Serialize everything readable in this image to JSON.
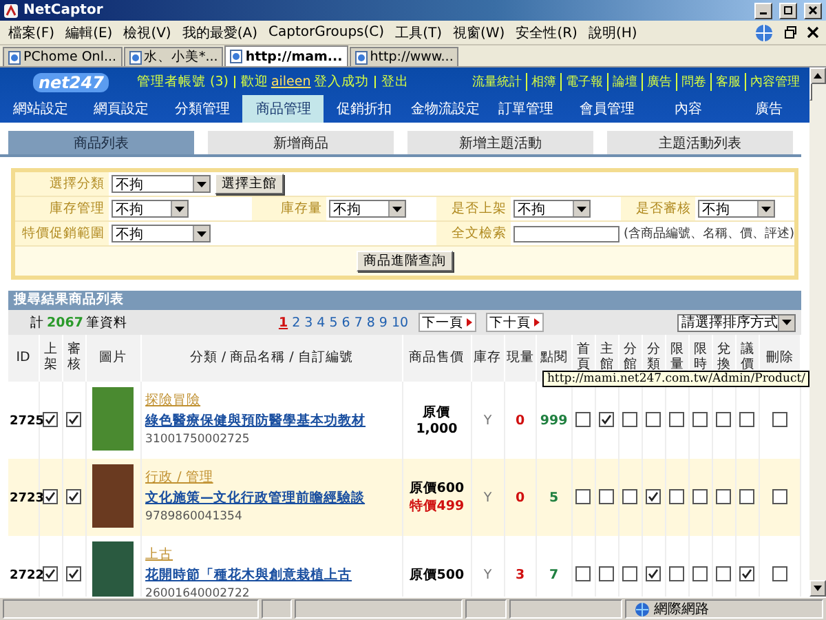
{
  "window": {
    "title": "NetCaptor"
  },
  "menu": [
    "檔案(F)",
    "編輯(E)",
    "檢視(V)",
    "我的最愛(A)",
    "CaptorGroups(C)",
    "工具(T)",
    "視窗(W)",
    "安全性(R)",
    "說明(H)"
  ],
  "browser_tabs": [
    {
      "label": "PChome Onl...",
      "selected": false
    },
    {
      "label": "水、小美*...",
      "selected": false
    },
    {
      "label": "http://mam...",
      "selected": true
    },
    {
      "label": "http://www...",
      "selected": false
    }
  ],
  "header": {
    "logo": "net247",
    "account": "管理者帳號 (3)",
    "greeting": "歡迎",
    "user": "aileen",
    "message": "登入成功",
    "logout": "登出",
    "links": [
      "流量統計",
      "相簿",
      "電子報",
      "論壇",
      "廣告",
      "問卷",
      "客服",
      "內容管理"
    ]
  },
  "nav": [
    {
      "label": "網站設定",
      "selected": false
    },
    {
      "label": "網頁設定",
      "selected": false
    },
    {
      "label": "分類管理",
      "selected": false
    },
    {
      "label": "商品管理",
      "selected": true
    },
    {
      "label": "促銷折扣",
      "selected": false
    },
    {
      "label": "金物流設定",
      "selected": false
    },
    {
      "label": "訂單管理",
      "selected": false
    },
    {
      "label": "會員管理",
      "selected": false
    },
    {
      "label": "內容",
      "selected": false
    },
    {
      "label": "廣告",
      "selected": false
    }
  ],
  "subtabs": [
    {
      "label": "商品列表",
      "selected": true
    },
    {
      "label": "新增商品",
      "selected": false
    },
    {
      "label": "新增主題活動",
      "selected": false
    },
    {
      "label": "主題活動列表",
      "selected": false
    }
  ],
  "search_form": {
    "rows": [
      [
        {
          "label": "選擇分類",
          "kind": "select",
          "value": "不拘",
          "button": "選擇主館"
        },
        "",
        "",
        ""
      ],
      [
        {
          "label": "庫存管理",
          "kind": "select",
          "value": "不拘"
        },
        {
          "label": "庫存量",
          "kind": "select",
          "value": "不拘"
        },
        {
          "label": "是否上架",
          "kind": "select",
          "value": "不拘"
        },
        {
          "label": "是否審核",
          "kind": "select",
          "value": "不拘"
        }
      ],
      [
        {
          "label": "特價促銷範圍",
          "kind": "select",
          "value": "不拘"
        },
        "",
        {
          "label": "全文檢索",
          "kind": "text",
          "note": "(含商品編號、名稱、價、評述)"
        },
        ""
      ]
    ],
    "submit": "商品進階查詢"
  },
  "results": {
    "title": "搜尋結果商品列表",
    "count_prefix": "計",
    "count": "2067",
    "count_suffix": "筆資料",
    "pages": [
      {
        "label": "1",
        "selected": true
      },
      {
        "label": "2",
        "selected": false
      },
      {
        "label": "3",
        "selected": false
      },
      {
        "label": "4",
        "selected": false
      },
      {
        "label": "5",
        "selected": false
      },
      {
        "label": "6",
        "selected": false
      },
      {
        "label": "7",
        "selected": false
      },
      {
        "label": "8",
        "selected": false
      },
      {
        "label": "9",
        "selected": false
      },
      {
        "label": "10",
        "selected": false
      }
    ],
    "next": "下一頁",
    "next_ten": "下十頁",
    "sort": "請選擇排序方式",
    "columns": [
      "ID",
      "上架",
      "審核",
      "圖片",
      "分類 / 商品名稱 / 自訂編號",
      "商品售價",
      "庫存",
      "現量",
      "點閱",
      "首頁",
      "主館",
      "分館",
      "分類",
      "限量",
      "限時",
      "兌換",
      "議價",
      "刪除"
    ],
    "rows": [
      {
        "id": "2725",
        "listed": true,
        "approved": true,
        "category": "探險冒險",
        "name": "綠色醫療保健與預防醫學基本功教材",
        "code": "31001750002725",
        "prices": [
          {
            "kind": "original",
            "text": "原價1,000"
          }
        ],
        "stock": "Y",
        "quantity": "0",
        "views": "999",
        "flags": [
          false,
          true,
          false,
          false,
          false,
          false,
          false,
          false
        ],
        "delete": false
      },
      {
        "id": "2723",
        "listed": true,
        "approved": true,
        "category": "行政 / 管理",
        "name": "文化施策—文化行政管理前瞻經驗談",
        "code": "9789860041354",
        "prices": [
          {
            "kind": "original",
            "text": "原價600"
          },
          {
            "kind": "special",
            "text": "特價499"
          }
        ],
        "stock": "Y",
        "quantity": "0",
        "views": "5",
        "flags": [
          false,
          false,
          false,
          true,
          false,
          false,
          false,
          false
        ],
        "delete": false
      },
      {
        "id": "2722",
        "listed": true,
        "approved": true,
        "category": "上古",
        "name": "花開時節「種花木與創意栽植上古",
        "code": "26001640002722",
        "prices": [
          {
            "kind": "original",
            "text": "原價500"
          }
        ],
        "stock": "Y",
        "quantity": "3",
        "views": "7",
        "flags": [
          false,
          false,
          false,
          true,
          false,
          false,
          false,
          true
        ],
        "delete": false
      }
    ]
  },
  "tooltip": "http://mami.net247.com.tw/Admin/Product/",
  "status_bar": {
    "zone": "網際網路"
  }
}
